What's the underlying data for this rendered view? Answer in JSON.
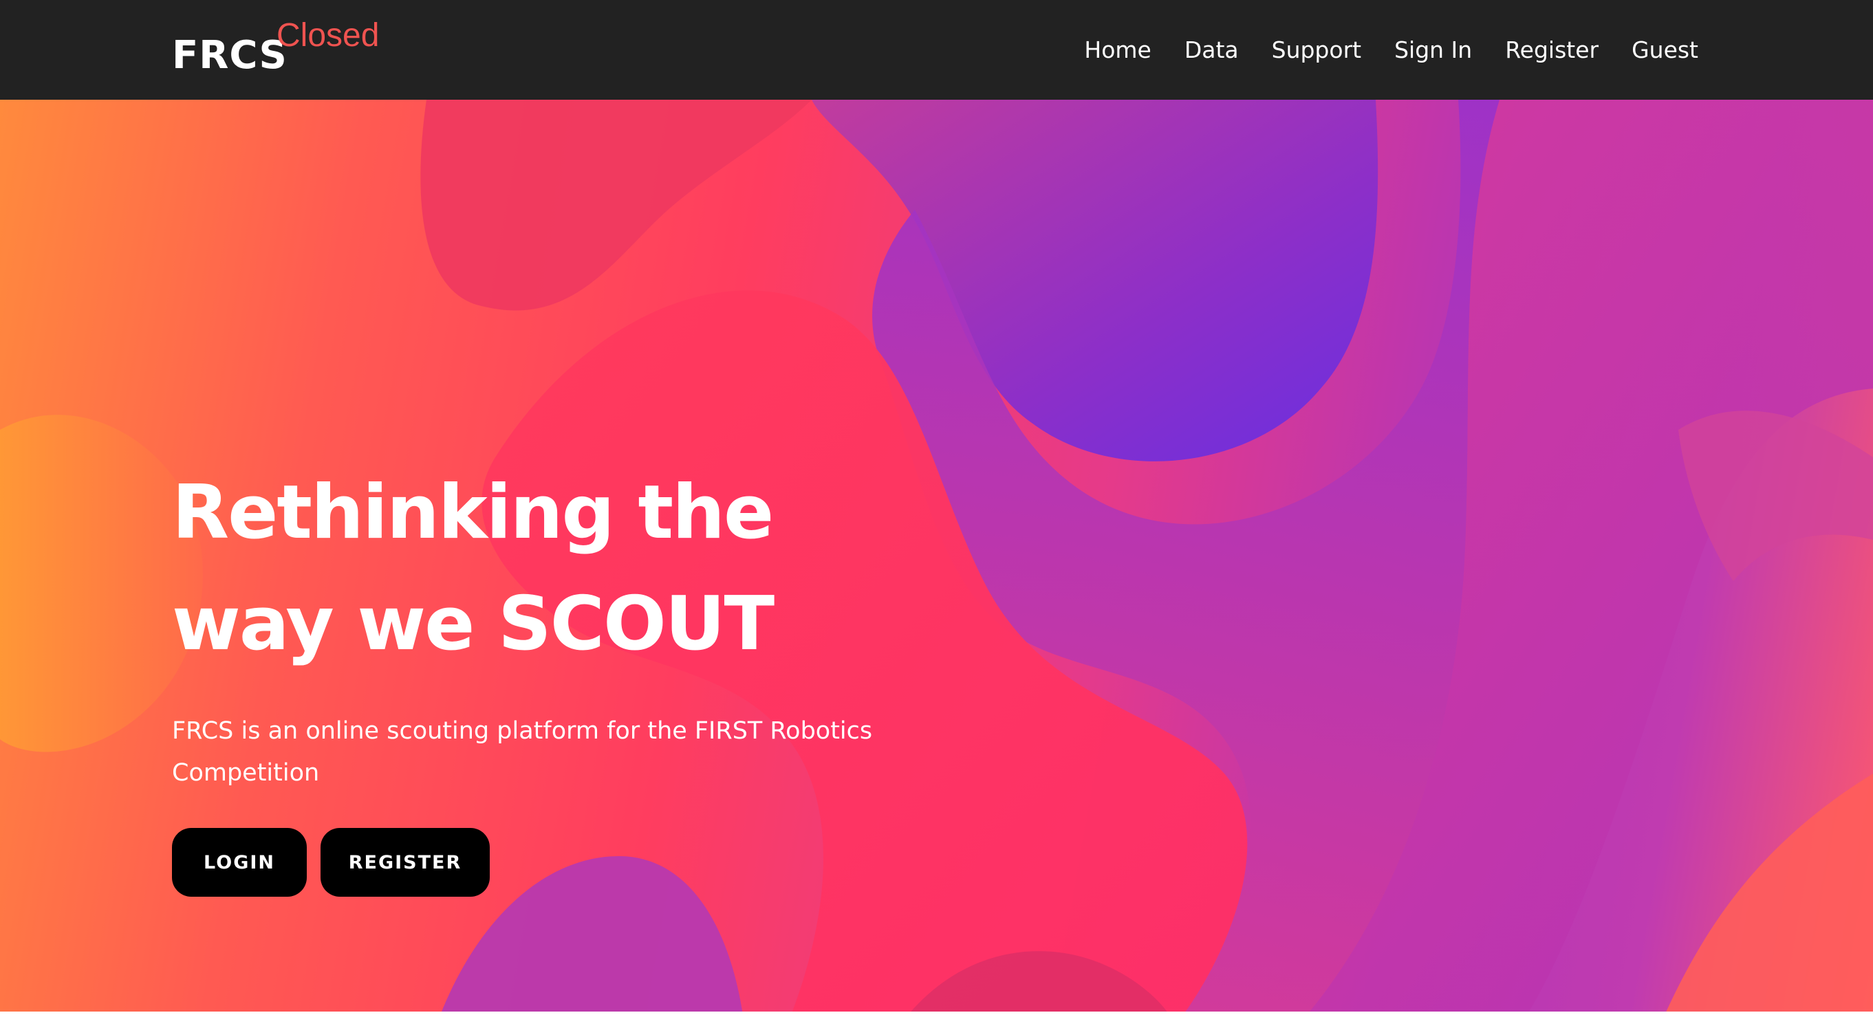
{
  "navbar": {
    "brand": "FRCS",
    "brand_sup": "Closed",
    "links": [
      "Home",
      "Data",
      "Support",
      "Sign In",
      "Register",
      "Guest"
    ]
  },
  "hero": {
    "title_line1": "Rethinking the",
    "title_line2": "way we SCOUT",
    "subtitle": "FRCS is an online scouting platform for the FIRST Robotics Competition",
    "buttons": {
      "login": "LOGIN",
      "register": "REGISTER"
    }
  },
  "colors": {
    "navbar_bg": "#222222",
    "brand_sup": "#ef5350",
    "button_bg": "#000000",
    "gradient": [
      "#ff8a3d",
      "#ff3d5f",
      "#e53a8a",
      "#b535b5",
      "#6a2fe0"
    ]
  }
}
